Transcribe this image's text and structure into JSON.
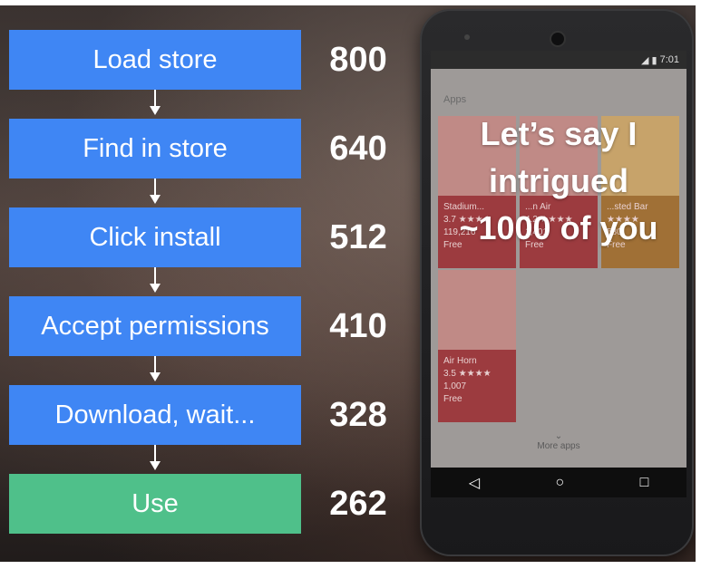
{
  "funnel": {
    "steps": [
      {
        "label": "Load store",
        "count": "800"
      },
      {
        "label": "Find in store",
        "count": "640"
      },
      {
        "label": "Click install",
        "count": "512"
      },
      {
        "label": "Accept permissions",
        "count": "410"
      },
      {
        "label": "Download, wait...",
        "count": "328"
      },
      {
        "label": "Use",
        "count": "262"
      }
    ],
    "colors": {
      "step": "#3f86f4",
      "final": "#4fc08a"
    }
  },
  "phone": {
    "time": "7:01",
    "section_label": "Apps",
    "apps": [
      {
        "name": "Stadium...",
        "rating": "3.7 ★★★★",
        "reviews": "119,216",
        "price": "Free"
      },
      {
        "name": "...n Air",
        "rating": "4.2 ★★★★",
        "reviews": "1,401",
        "price": "Free"
      },
      {
        "name": "...sted Bar",
        "rating": "★★★★",
        "reviews": "580",
        "price": "Free"
      },
      {
        "name": "Air Horn",
        "rating": "3.5 ★★★★",
        "reviews": "1,007",
        "price": "Free"
      }
    ],
    "more_label": "More apps",
    "nav": {
      "back": "◁",
      "home": "○",
      "recent": "□"
    },
    "overlay": [
      "Let’s say I",
      "intrigued",
      "~1000 of you"
    ]
  }
}
